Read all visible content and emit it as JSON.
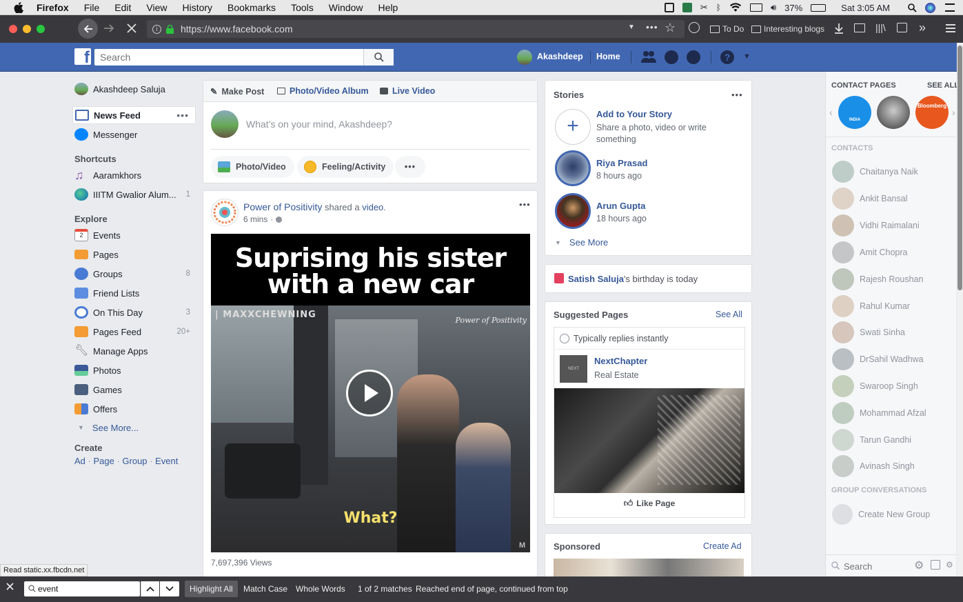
{
  "macbar": {
    "app": "Firefox",
    "menus": [
      "File",
      "Edit",
      "View",
      "History",
      "Bookmarks",
      "Tools",
      "Window",
      "Help"
    ],
    "battery": "37%",
    "clock": "Sat 3:05 AM"
  },
  "browser": {
    "url": "https://www.facebook.com",
    "bookmarks": [
      "To Do",
      "Interesting blogs"
    ]
  },
  "fbheader": {
    "search_placeholder": "Search",
    "user": "Akashdeep",
    "home": "Home"
  },
  "left": {
    "profile_name": "Akashdeep Saluja",
    "news_feed": "News Feed",
    "messenger": "Messenger",
    "shortcuts_title": "Shortcuts",
    "shortcuts": [
      {
        "label": "Aaramkhors",
        "count": ""
      },
      {
        "label": "IIITM Gwalior Alum...",
        "count": "1"
      }
    ],
    "explore_title": "Explore",
    "explore": [
      {
        "label": "Events",
        "count": ""
      },
      {
        "label": "Pages",
        "count": ""
      },
      {
        "label": "Groups",
        "count": "8"
      },
      {
        "label": "Friend Lists",
        "count": ""
      },
      {
        "label": "On This Day",
        "count": "3"
      },
      {
        "label": "Pages Feed",
        "count": "20+"
      },
      {
        "label": "Manage Apps",
        "count": ""
      },
      {
        "label": "Photos",
        "count": ""
      },
      {
        "label": "Games",
        "count": ""
      },
      {
        "label": "Offers",
        "count": ""
      }
    ],
    "see_more": "See More...",
    "create_title": "Create",
    "create_links": [
      "Ad",
      "Page",
      "Group",
      "Event"
    ],
    "events_icon_number": "2"
  },
  "composer": {
    "tabs": [
      "Make Post",
      "Photo/Video Album",
      "Live Video"
    ],
    "placeholder": "What's on your mind, Akashdeep?",
    "actions": [
      "Photo/Video",
      "Feeling/Activity"
    ]
  },
  "post": {
    "page_name": "Power of Positivity",
    "shared_text": " shared a ",
    "shared_link": "video",
    "time": "6 mins",
    "video_title_line1": "Suprising his sister",
    "video_title_line2": "with a new car",
    "watermark": "| MAXXCHEWNING",
    "brand": "Power of Positivity",
    "caption": "What?",
    "views": "7,697,396 Views"
  },
  "stories": {
    "title": "Stories",
    "add_title": "Add to Your Story",
    "add_sub": "Share a photo, video or write something",
    "items": [
      {
        "name": "Riya Prasad",
        "time": "8 hours ago"
      },
      {
        "name": "Arun Gupta",
        "time": "18 hours ago"
      }
    ],
    "see_more": "See More"
  },
  "birthday": {
    "name": "Satish Saluja",
    "text": "'s birthday is today"
  },
  "suggested": {
    "title": "Suggested Pages",
    "see_all": "See All",
    "replies": "Typically replies instantly",
    "page_name": "NextChapter",
    "page_cat": "Real Estate",
    "like": "Like Page"
  },
  "sponsored": {
    "title": "Sponsored",
    "create_ad": "Create Ad"
  },
  "chat": {
    "contact_pages": "CONTACT PAGES",
    "see_all": "SEE ALL",
    "contacts_title": "CONTACTS",
    "contacts": [
      "Chaitanya Naik",
      "Ankit Bansal",
      "Vidhi Raimalani",
      "Amit Chopra",
      "Rajesh Roushan",
      "Rahul Kumar",
      "Swati Sinha",
      "DrSahil Wadhwa",
      "Swaroop Singh",
      "Mohammad Afzal",
      "Tarun Gandhi",
      "Avinash Singh"
    ],
    "group_title": "GROUP CONVERSATIONS",
    "create_group": "Create New Group",
    "search_placeholder": "Search",
    "page_badges": [
      "INDIA",
      "Bloomberg"
    ]
  },
  "status": "Read static.xx.fbcdn.net",
  "find": {
    "query": "event",
    "highlight_all": "Highlight All",
    "match_case": "Match Case",
    "whole_words": "Whole Words",
    "result": "1 of 2 matches",
    "message": "Reached end of page, continued from top"
  }
}
